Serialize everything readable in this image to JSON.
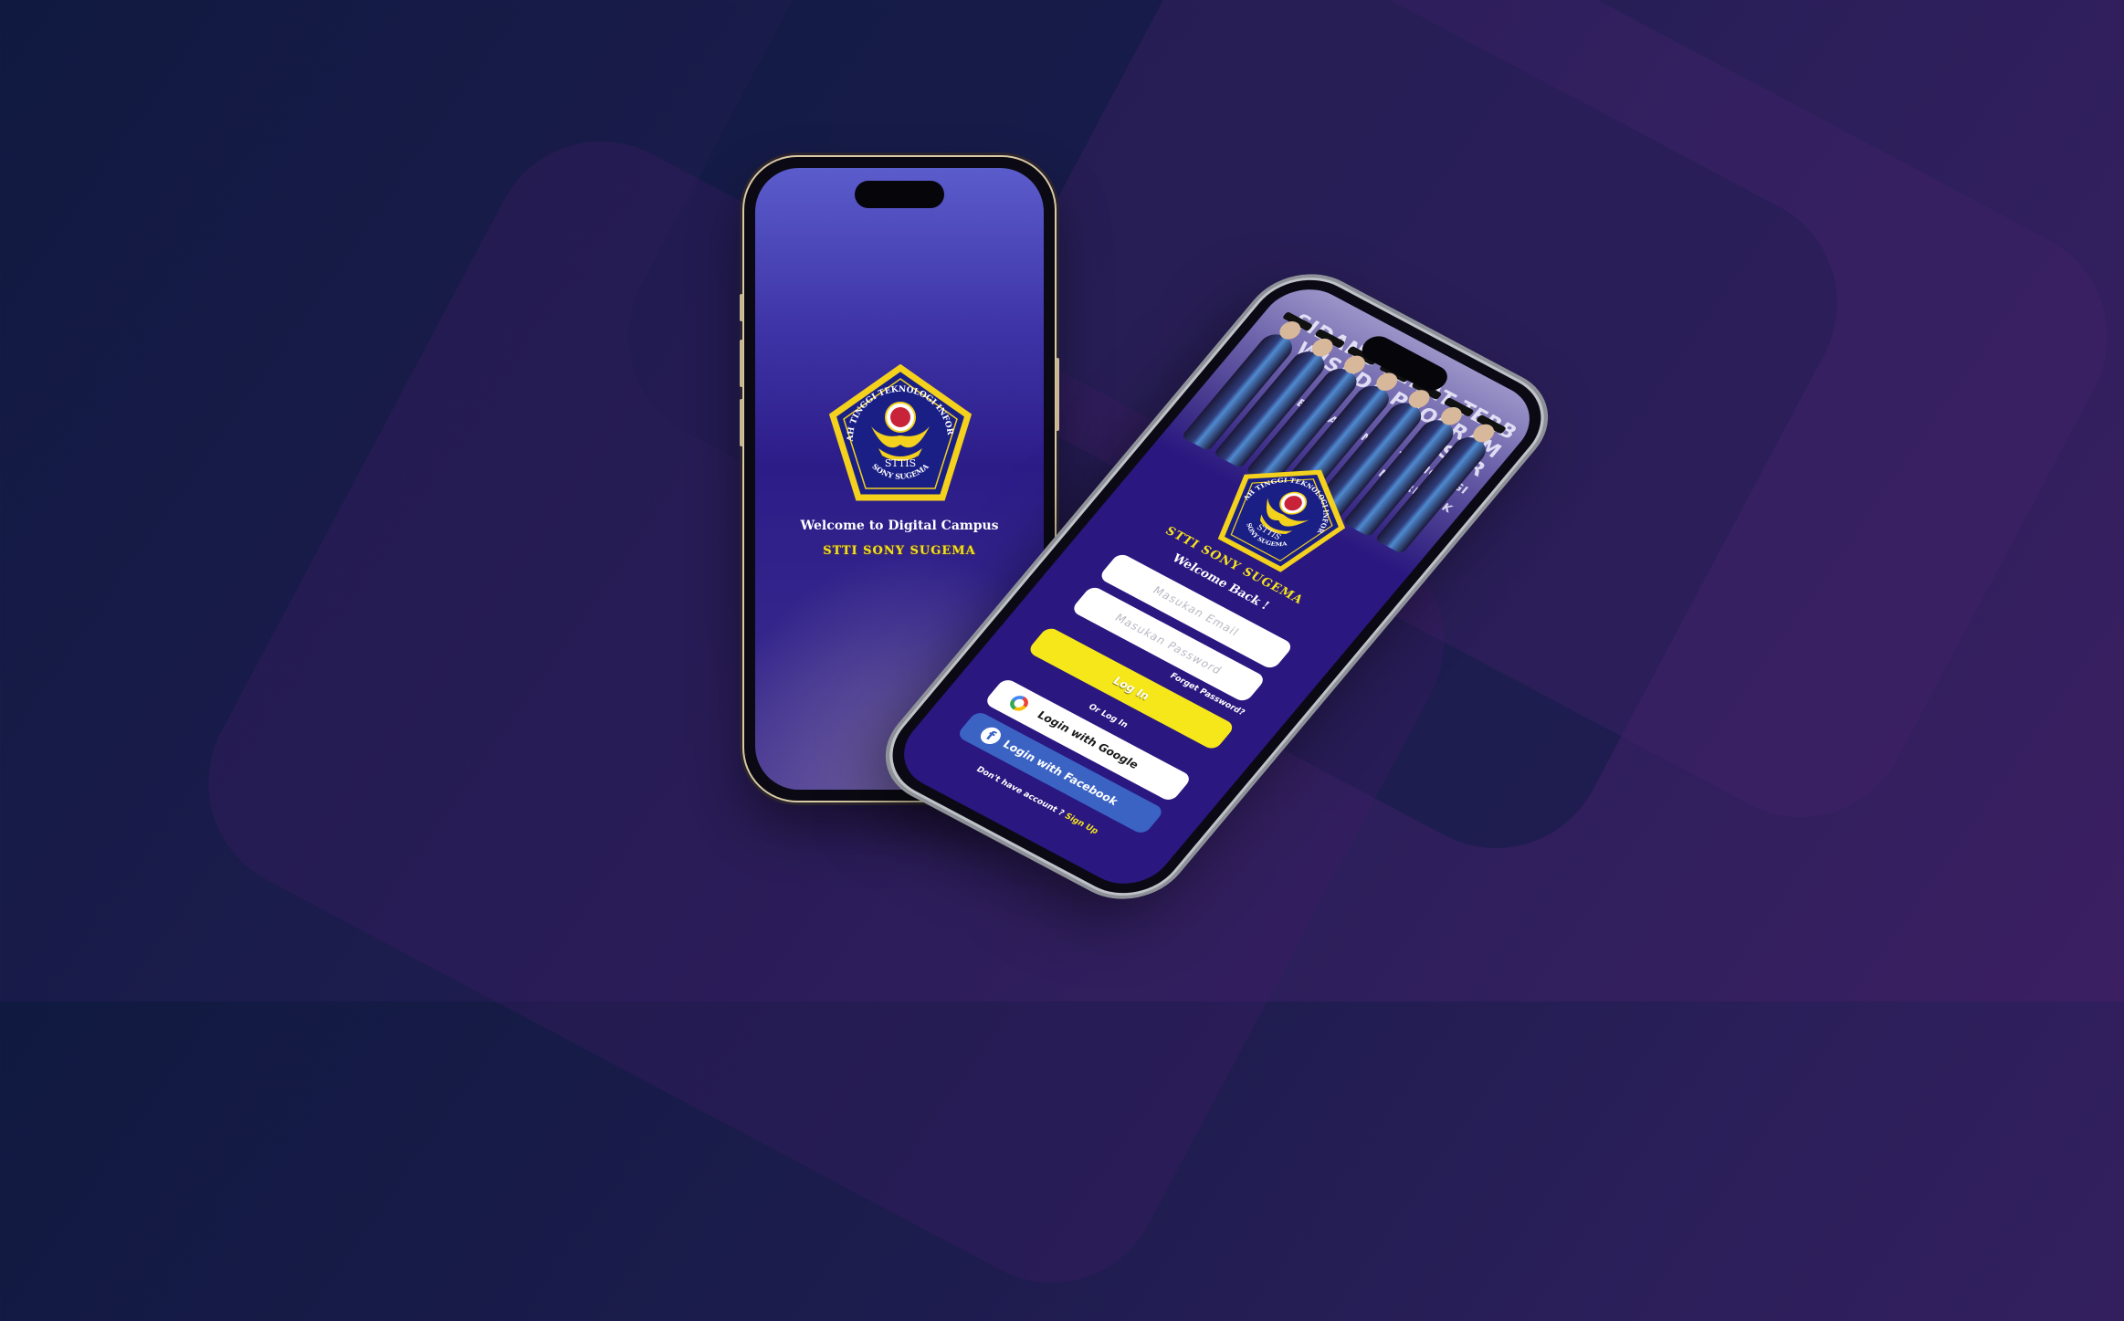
{
  "splash": {
    "title": "Welcome  to Digital Campus",
    "subtitle": "STTI SONY SUGEMA"
  },
  "emblem": {
    "ring_text": "SEKOLAH TINGGI TEKNOLOGI INFORMATIKA",
    "center_text": "STTIS",
    "bottom_text": "SONY SUGEMA"
  },
  "login": {
    "banner_lines": [
      "SIDANG SENAT TERB",
      "WISUDA PROGRAM SAR",
      "SEKOLAH TINGGI TEKNOLOGI INFORMATIK"
    ],
    "brand": "STTI SONY SUGEMA",
    "welcome": "Welcome Back !",
    "email_placeholder": "Masukan Email",
    "password_placeholder": "Masukan Password",
    "forget_password": "Forget Password?",
    "login_button": "Log In",
    "or_text": "Or Log In",
    "google_button": "Login with Google",
    "facebook_button": "Login with Facebook",
    "signup_prompt": "Don't have account ?",
    "signup_link": "Sign Up"
  },
  "colors": {
    "accent_yellow": "#f5e71a",
    "screen_purple": "#2a1780",
    "facebook_blue": "#3a63c4"
  }
}
